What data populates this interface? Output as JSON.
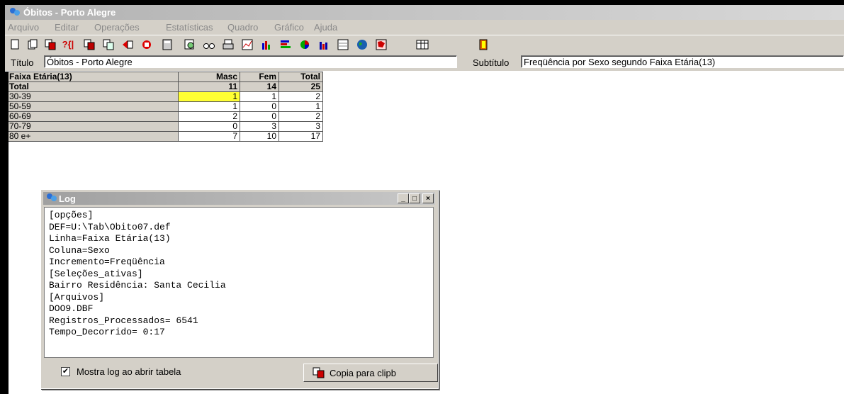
{
  "window": {
    "title": "Óbitos - Porto Alegre"
  },
  "menu": [
    "Arquivo",
    "Editar",
    "Operações",
    "Estatísticas",
    "Quadro",
    "Gráfico",
    "Ajuda"
  ],
  "toolbar": {
    "icons": [
      "new-icon",
      "open-icon",
      "copy-icon",
      "help-icon",
      "paste-icon",
      "copy2-icon",
      "cut-icon",
      "stop-icon",
      "calculator-icon",
      "print-preview-icon",
      "binoculars-icon",
      "printer-icon",
      "line-chart-icon",
      "bar-chart-icon",
      "hbar-chart-icon",
      "pie-chart-icon",
      "column-chart-icon",
      "table-chart-icon",
      "globe-icon",
      "map-icon",
      "grid-icon",
      "exit-icon"
    ]
  },
  "titleline": {
    "title_label": "Título",
    "title_value": "Óbitos - Porto Alegre",
    "subtitle_label": "Subtítulo",
    "subtitle_value": "Freqüência por Sexo segundo Faixa Etária(13)"
  },
  "table": {
    "headers": [
      "Faixa Etária(13)",
      "Masc",
      "Fem",
      "Total"
    ],
    "total_row": [
      "Total",
      "11",
      "14",
      "25"
    ],
    "rows": [
      [
        "30-39",
        "1",
        "1",
        "2"
      ],
      [
        "50-59",
        "1",
        "0",
        "1"
      ],
      [
        "60-69",
        "2",
        "0",
        "2"
      ],
      [
        "70-79",
        "0",
        "3",
        "3"
      ],
      [
        "80 e+",
        "7",
        "10",
        "17"
      ]
    ]
  },
  "log": {
    "title": "Log",
    "lines": [
      "[opções]",
      "DEF=U:\\Tab\\Obito07.def",
      "Linha=Faixa Etária(13)",
      "Coluna=Sexo",
      "Incremento=Freqüência",
      "[Seleções_ativas]",
      "Bairro Residência: Santa Cecilia",
      "[Arquivos]",
      "DOO9.DBF",
      "Registros_Processados= 6541",
      "Tempo_Decorrido= 0:17"
    ],
    "checkbox_label": "Mostra log ao abrir tabela",
    "copy_button": "Copia para clipb"
  }
}
